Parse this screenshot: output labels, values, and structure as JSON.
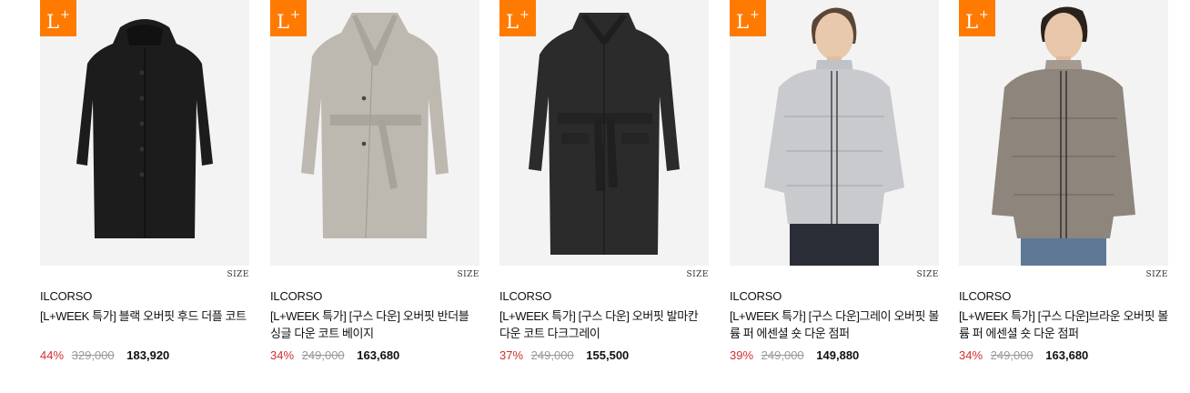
{
  "products": [
    {
      "badge": {
        "main": "L",
        "sup": "+"
      },
      "size_label": "SIZE",
      "brand": "ILCORSO",
      "name": "[L+WEEK 특가] 블랙 오버핏 후드 더플 코트",
      "discount": "44%",
      "original_price": "329,000",
      "sale_price": "183,920",
      "image": "black-hooded-duffle-coat",
      "colors": {
        "bg": "#f3f3f3",
        "garment": "#1c1c1c"
      }
    },
    {
      "badge": {
        "main": "L",
        "sup": "+"
      },
      "size_label": "SIZE",
      "brand": "ILCORSO",
      "name": "[L+WEEK 특가] [구스 다운] 오버핏 반더블 싱글 다운 코트 베이지",
      "discount": "34%",
      "original_price": "249,000",
      "sale_price": "163,680",
      "image": "beige-belted-down-coat",
      "colors": {
        "bg": "#f3f3f3",
        "garment": "#bdb8b0"
      }
    },
    {
      "badge": {
        "main": "L",
        "sup": "+"
      },
      "size_label": "SIZE",
      "brand": "ILCORSO",
      "name": "[L+WEEK 특가] [구스 다운] 오버핏 발마칸 다운 코트 다크그레이",
      "discount": "37%",
      "original_price": "249,000",
      "sale_price": "155,500",
      "image": "dark-grey-belted-down-coat",
      "colors": {
        "bg": "#f3f3f3",
        "garment": "#2b2b2b"
      }
    },
    {
      "badge": {
        "main": "L",
        "sup": "+"
      },
      "size_label": "SIZE",
      "brand": "ILCORSO",
      "name": "[L+WEEK 특가] [구스 다운]그레이 오버핏 볼륨 퍼 에센셜 숏 다운 점퍼",
      "discount": "39%",
      "original_price": "249,000",
      "sale_price": "149,880",
      "image": "grey-short-down-jacket-model",
      "colors": {
        "bg": "#f3f3f3",
        "garment": "#c8cacd"
      }
    },
    {
      "badge": {
        "main": "L",
        "sup": "+"
      },
      "size_label": "SIZE",
      "brand": "ILCORSO",
      "name": "[L+WEEK 특가] [구스 다운]브라운 오버핏 볼륨 퍼 에센셜 숏 다운 점퍼",
      "discount": "34%",
      "original_price": "249,000",
      "sale_price": "163,680",
      "image": "brown-short-down-jacket-model",
      "colors": {
        "bg": "#f3f3f3",
        "garment": "#8e857c"
      }
    }
  ],
  "colors": {
    "badge": "#ff7a00",
    "discount": "#d32f2f",
    "original": "#9a9a9a"
  }
}
